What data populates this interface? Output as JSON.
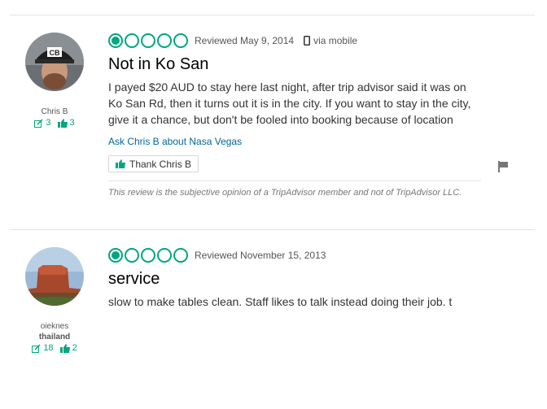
{
  "colors": {
    "accent": "#00a680",
    "link": "#006699"
  },
  "reviews": [
    {
      "member": {
        "username": "Chris B",
        "location": "",
        "contributions": "3",
        "helpful_votes": "3"
      },
      "rating": {
        "bubbles_filled": 1,
        "bubbles_total": 5,
        "date_text": "Reviewed May 9, 2014",
        "via_mobile": "via mobile"
      },
      "title": "Not in Ko San",
      "body": "I payed $20 AUD to stay here last night, after trip advisor said it was on Ko San Rd, then it turns out it is in the city. If you want to stay in the city, give it a chance, but don't be fooled into booking because of location",
      "ask_link": "Ask Chris B about Nasa Vegas",
      "thank_button": "Thank Chris B",
      "disclaimer": "This review is the subjective opinion of a TripAdvisor member and not of TripAdvisor LLC."
    },
    {
      "member": {
        "username": "oieknes",
        "location": "thailand",
        "contributions": "18",
        "helpful_votes": "2"
      },
      "rating": {
        "bubbles_filled": 1,
        "bubbles_total": 5,
        "date_text": "Reviewed November 15, 2013"
      },
      "title": "service",
      "body": "slow to make tables clean. Staff likes to talk instead doing their job. t"
    }
  ],
  "icons": [
    "review-count-icon",
    "helpful-votes-icon",
    "mobile-phone-icon",
    "thumbs-up-icon",
    "flag-icon"
  ]
}
